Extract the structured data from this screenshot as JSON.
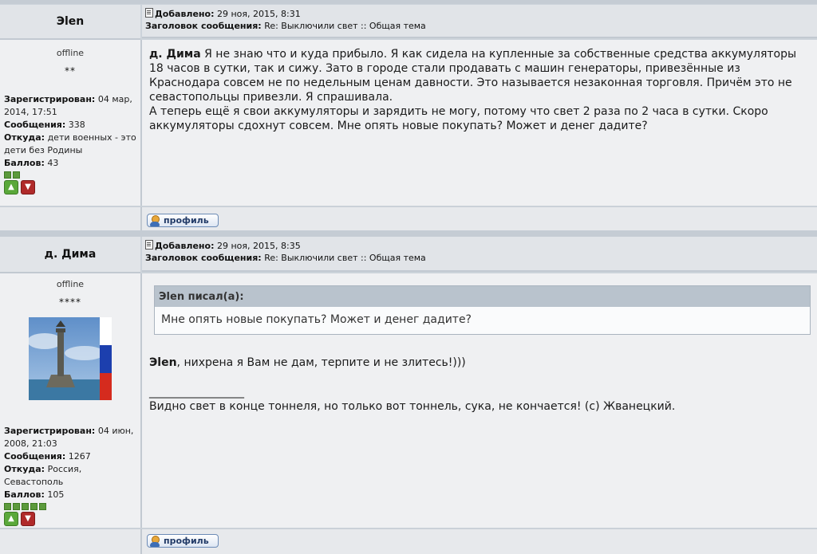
{
  "posts": [
    {
      "author": "Эlen",
      "status": "offline",
      "rank": "**",
      "added_label": "Добавлено:",
      "added_date": "29 ноя, 2015, 8:31",
      "subject_label": "Заголовок сообщения:",
      "subject": "Re: Выключили свет :: Общая тема",
      "registered_label": "Зарегистрирован:",
      "registered": "04 мар, 2014, 17:51",
      "messages_label": "Сообщения:",
      "messages": "338",
      "from_label": "Откуда:",
      "from": "дети военных - это дети без Родины",
      "points_label": "Баллов:",
      "points": "43",
      "level_squares": 2,
      "body_mention": "д. Дима",
      "body_p1": "Я не знаю что и куда прибыло. Я как сидела на купленные за собственные средства аккумуляторы 18 часов в сутки, так и сижу. Зато в городе стали продавать с машин генераторы, привезённые из Краснодара совсем не по недельным ценам давности. Это называется незаконная торговля. Причём это не севастопольцы привезли. Я спрашивала.",
      "body_p2": "А теперь ещё я свои аккумуляторы и зарядить не могу, потому что свет 2 раза по 2 часа в сутки. Скоро аккумуляторы сдохнут совсем. Мне опять новые покупать? Может и денег дадите?",
      "profile_label": "профиль"
    },
    {
      "author": "д. Дима",
      "status": "offline",
      "rank": "****",
      "added_label": "Добавлено:",
      "added_date": "29 ноя, 2015, 8:35",
      "subject_label": "Заголовок сообщения:",
      "subject": "Re: Выключили свет :: Общая тема",
      "registered_label": "Зарегистрирован:",
      "registered": "04 июн, 2008, 21:03",
      "messages_label": "Сообщения:",
      "messages": "1267",
      "from_label": "Откуда:",
      "from": "Россия, Севастополь",
      "points_label": "Баллов:",
      "points": "105",
      "level_squares": 5,
      "quote_header": "Эlen писал(а):",
      "quote_text": "Мне опять новые покупать? Может и денег дадите?",
      "reply_mention": "Эlen",
      "reply_text": ", нихрена я Вам не дам, терпите и не злитесь!)))",
      "signature_line": "_________________",
      "signature": "Видно свет в конце тоннеля, но только вот тоннель, сука, не кончается! (с) Жванецкий.",
      "profile_label": "профиль"
    }
  ],
  "icons": {
    "post": "post-icon",
    "thumb_up": "thumbs-up-icon",
    "thumb_down": "thumbs-down-icon",
    "profile": "user-icon"
  },
  "colors": {
    "header_bg": "#e1e4e8",
    "body_bg": "#eff0f2",
    "quote_header_bg": "#b9c3cd",
    "profile_text": "#213a67"
  }
}
